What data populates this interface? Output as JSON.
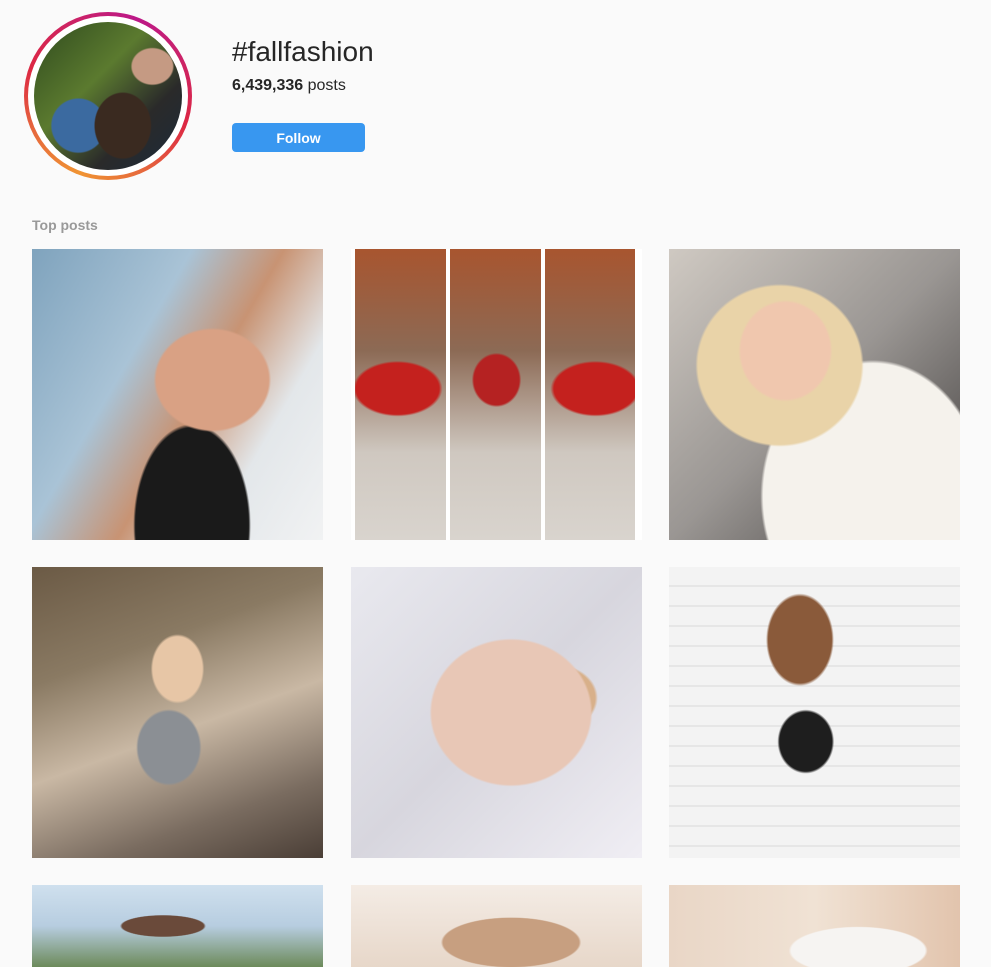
{
  "header": {
    "hashtag": "#fallfashion",
    "post_count": "6,439,336",
    "post_count_suffix": " posts",
    "follow_label": "Follow"
  },
  "colors": {
    "follow_button": "#3897f0",
    "page_background": "#fafafa",
    "section_label": "#999999"
  },
  "section": {
    "top_posts_label": "Top posts"
  },
  "posts": [
    {
      "id": "post-1",
      "description_icon": "image"
    },
    {
      "id": "post-2",
      "description_icon": "image"
    },
    {
      "id": "post-3",
      "description_icon": "image"
    },
    {
      "id": "post-4",
      "description_icon": "image"
    },
    {
      "id": "post-5",
      "description_icon": "image"
    },
    {
      "id": "post-6",
      "description_icon": "image"
    },
    {
      "id": "post-7",
      "description_icon": "image"
    },
    {
      "id": "post-8",
      "description_icon": "image"
    },
    {
      "id": "post-9",
      "description_icon": "image"
    }
  ]
}
